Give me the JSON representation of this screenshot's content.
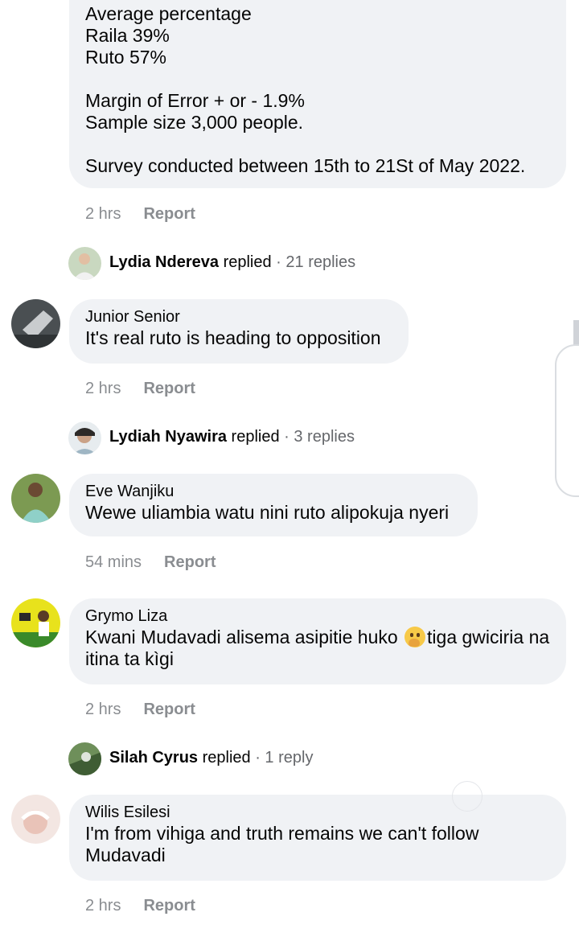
{
  "post": {
    "lines": "Average percentage\nRaila 39%\nRuto 57%\n\nMargin of Error + or - 1.9%\nSample size 3,000 people.\n\nSurvey conducted between 15th to 21St of May 2022.",
    "time": "2 hrs",
    "report": "Report"
  },
  "reply_summaries": [
    {
      "name": "Lydia Ndereva",
      "verb": "replied",
      "count": "· 21 replies"
    },
    {
      "name": "Lydiah Nyawira",
      "verb": "replied",
      "count": "· 3 replies"
    },
    {
      "name": "Silah Cyrus",
      "verb": "replied",
      "count": "· 1 reply"
    }
  ],
  "comments": [
    {
      "author": "Junior Senior",
      "text": "It's real ruto is heading to opposition",
      "time": "2 hrs",
      "report": "Report"
    },
    {
      "author": "Eve Wanjiku",
      "text": "Wewe uliambia watu nini ruto alipokuja nyeri",
      "time": "54 mins",
      "report": "Report"
    },
    {
      "author": "Grymo Liza",
      "text_before_emoji": "Kwani Mudavadi alisema asipitie huko ",
      "text_after_emoji": "tiga gwiciria na itina ta kìgi",
      "emoji": "thinking-face",
      "time": "2 hrs",
      "report": "Report"
    },
    {
      "author": "Wilis Esilesi",
      "text": "I'm from vihiga and truth remains we can't follow Mudavadi",
      "time": "2 hrs",
      "report": "Report"
    }
  ]
}
